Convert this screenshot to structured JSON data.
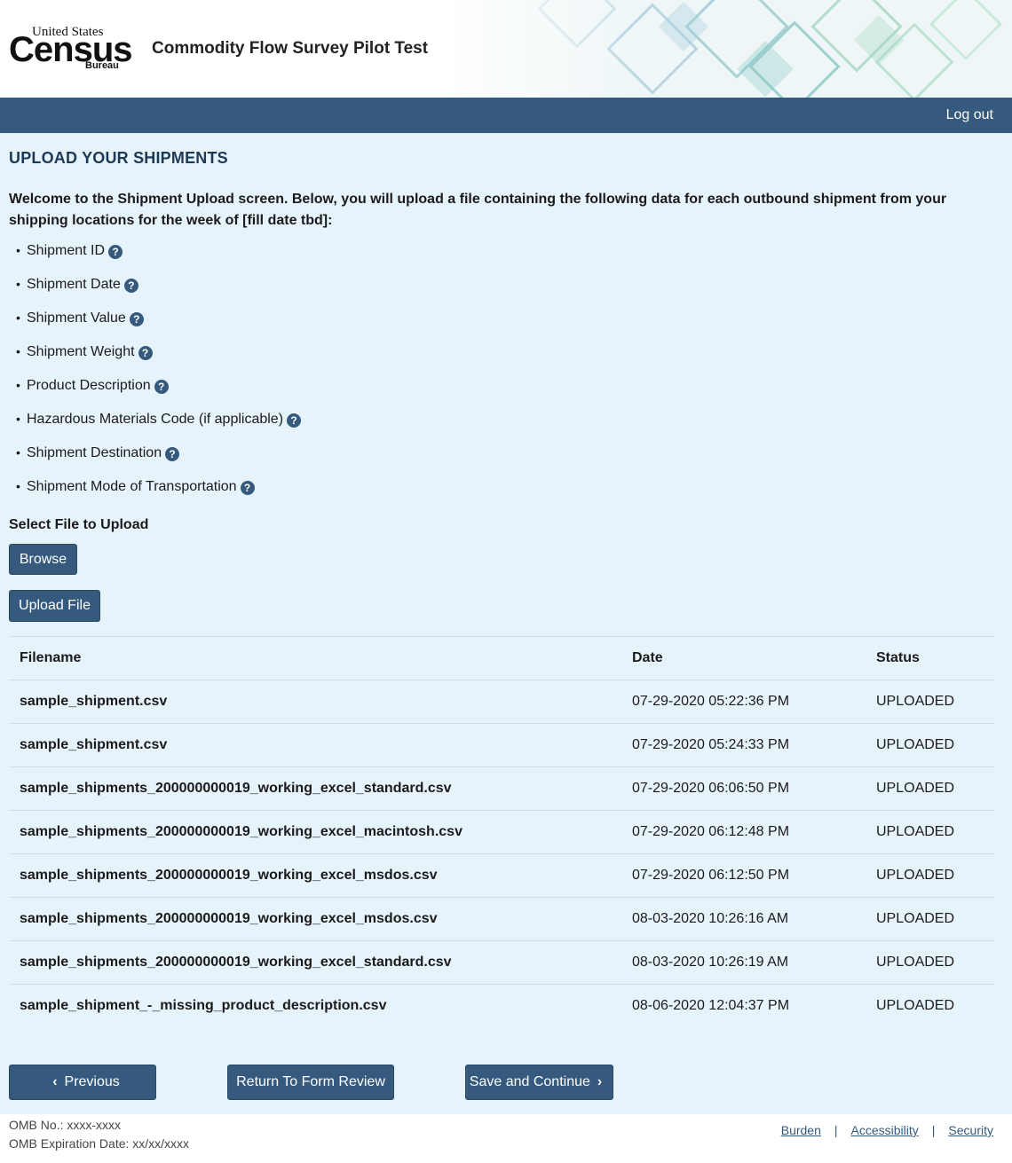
{
  "header": {
    "logo_line1": "United States",
    "logo_main": "Census",
    "logo_sub": "Bureau",
    "app_title": "Commodity Flow Survey Pilot Test"
  },
  "nav": {
    "logout_label": "Log out"
  },
  "main": {
    "page_title": "UPLOAD YOUR SHIPMENTS",
    "intro": "Welcome to the Shipment Upload screen. Below, you will upload a file containing the following data for each outbound shipment from your shipping locations for the week of [fill date tbd]:",
    "requirements": [
      "Shipment ID",
      "Shipment Date",
      "Shipment Value",
      "Shipment Weight",
      "Product Description",
      "Hazardous Materials Code (if applicable)",
      "Shipment Destination",
      "Shipment Mode of Transportation"
    ],
    "select_label": "Select File to Upload",
    "browse_label": "Browse",
    "upload_label": "Upload File"
  },
  "table": {
    "headers": [
      "Filename",
      "Date",
      "Status"
    ],
    "rows": [
      {
        "filename": "sample_shipment.csv",
        "date": "07-29-2020 05:22:36 PM",
        "status": "UPLOADED"
      },
      {
        "filename": "sample_shipment.csv",
        "date": "07-29-2020 05:24:33 PM",
        "status": "UPLOADED"
      },
      {
        "filename": "sample_shipments_200000000019_working_excel_standard.csv",
        "date": "07-29-2020 06:06:50 PM",
        "status": "UPLOADED"
      },
      {
        "filename": "sample_shipments_200000000019_working_excel_macintosh.csv",
        "date": "07-29-2020 06:12:48 PM",
        "status": "UPLOADED"
      },
      {
        "filename": "sample_shipments_200000000019_working_excel_msdos.csv",
        "date": "07-29-2020 06:12:50 PM",
        "status": "UPLOADED"
      },
      {
        "filename": "sample_shipments_200000000019_working_excel_msdos.csv",
        "date": "08-03-2020 10:26:16 AM",
        "status": "UPLOADED"
      },
      {
        "filename": "sample_shipments_200000000019_working_excel_standard.csv",
        "date": "08-03-2020 10:26:19 AM",
        "status": "UPLOADED"
      },
      {
        "filename": "sample_shipment_-_missing_product_description.csv",
        "date": "08-06-2020 12:04:37 PM",
        "status": "UPLOADED"
      }
    ]
  },
  "actions": {
    "previous_label": "Previous",
    "return_label": "Return To Form Review",
    "save_label": "Save and Continue"
  },
  "footer": {
    "omb_no": "OMB No.: xxxx-xxxx",
    "omb_exp": "OMB Expiration Date: xx/xx/xxxx",
    "links": [
      "Burden",
      "Accessibility",
      "Security"
    ],
    "separator": "|"
  },
  "colors": {
    "primary": "#355a7d",
    "background": "#e6f3fb",
    "title": "#1e3956"
  }
}
